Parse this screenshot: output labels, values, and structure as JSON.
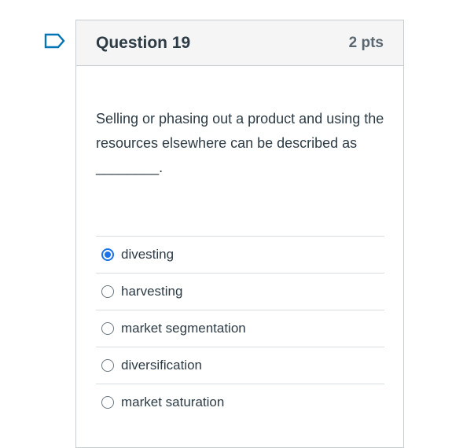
{
  "question": {
    "title": "Question 19",
    "points": "2 pts",
    "text": "Selling or phasing out a product and using the resources elsewhere can be described as ________.",
    "flag_icon": "bookmark-flag-icon"
  },
  "answers": [
    {
      "label": "divesting",
      "selected": true
    },
    {
      "label": "harvesting",
      "selected": false
    },
    {
      "label": "market segmentation",
      "selected": false
    },
    {
      "label": "diversification",
      "selected": false
    },
    {
      "label": "market saturation",
      "selected": false
    }
  ],
  "colors": {
    "accent": "#1a73e8",
    "flag": "#0374b5"
  }
}
